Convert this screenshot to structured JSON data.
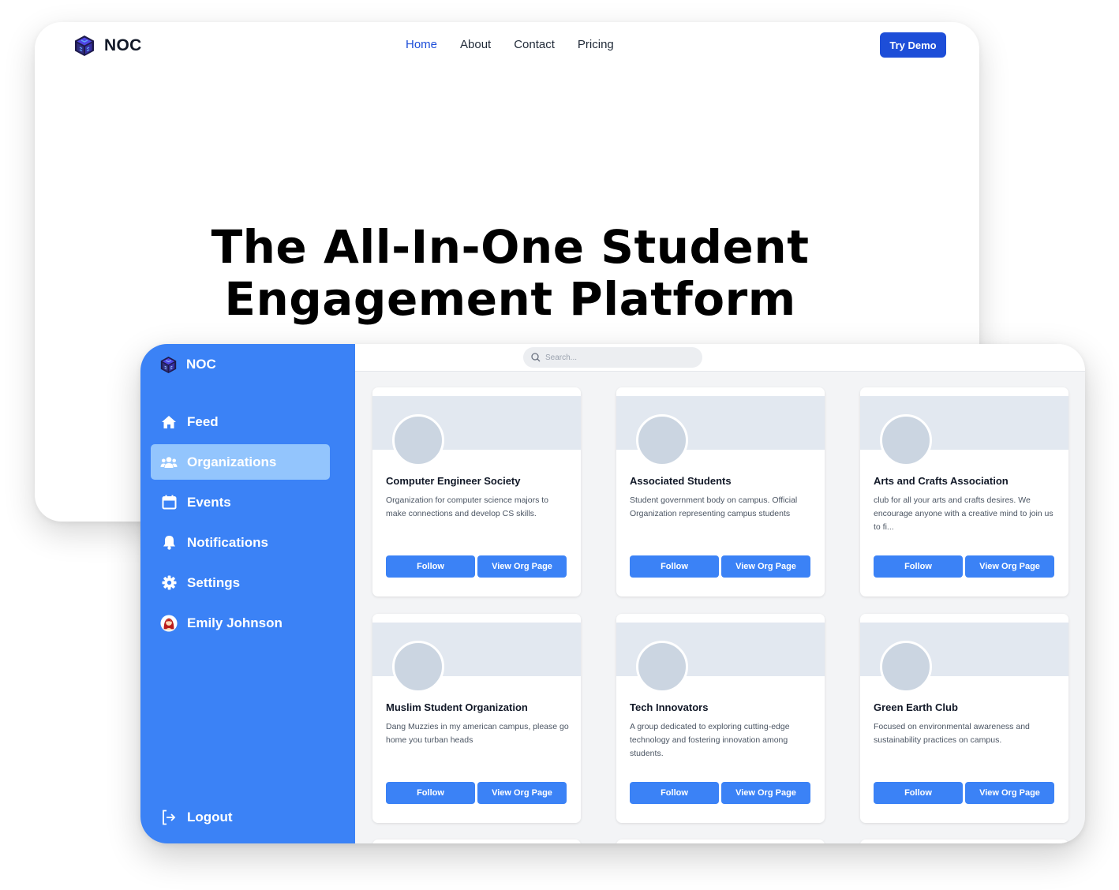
{
  "landing": {
    "brand": "NOC",
    "nav": [
      "Home",
      "About",
      "Contact",
      "Pricing"
    ],
    "try_demo": "Try Demo",
    "hero_line1": "The All-In-One Student",
    "hero_line2": "Engagement Platform"
  },
  "app": {
    "brand": "NOC",
    "sidebar": {
      "items": [
        {
          "label": "Feed",
          "icon": "home-icon"
        },
        {
          "label": "Organizations",
          "icon": "users-icon",
          "active": true
        },
        {
          "label": "Events",
          "icon": "calendar-icon"
        },
        {
          "label": "Notifications",
          "icon": "bell-icon"
        },
        {
          "label": "Settings",
          "icon": "gear-icon"
        },
        {
          "label": "Emily Johnson",
          "icon": "avatar"
        }
      ],
      "logout": "Logout"
    },
    "search": {
      "placeholder": "Search..."
    },
    "orgs": [
      {
        "name": "Computer Engineer Society",
        "description": "Organization for computer science majors to make connections and develop CS skills."
      },
      {
        "name": "Associated Students",
        "description": "Student government body on campus. Official Organization representing campus students"
      },
      {
        "name": "Arts and Crafts Association",
        "description": "club for all your arts and crafts desires. We encourage anyone with a creative mind to join us to fi..."
      },
      {
        "name": "Muslim Student Organization",
        "description": "Dang Muzzies in my american campus, please go home you turban heads"
      },
      {
        "name": "Tech Innovators",
        "description": "A group dedicated to exploring cutting-edge technology and fostering innovation among students."
      },
      {
        "name": "Green Earth Club",
        "description": "Focused on environmental awareness and sustainability practices on campus."
      }
    ],
    "follow_label": "Follow",
    "view_label": "View Org Page"
  },
  "colors": {
    "primary": "#3b82f6",
    "primary_dark": "#1d4ed8",
    "active_nav": "#93c5fd",
    "card_banner": "#e2e8f0",
    "avatar_placeholder": "#cbd5e1"
  }
}
